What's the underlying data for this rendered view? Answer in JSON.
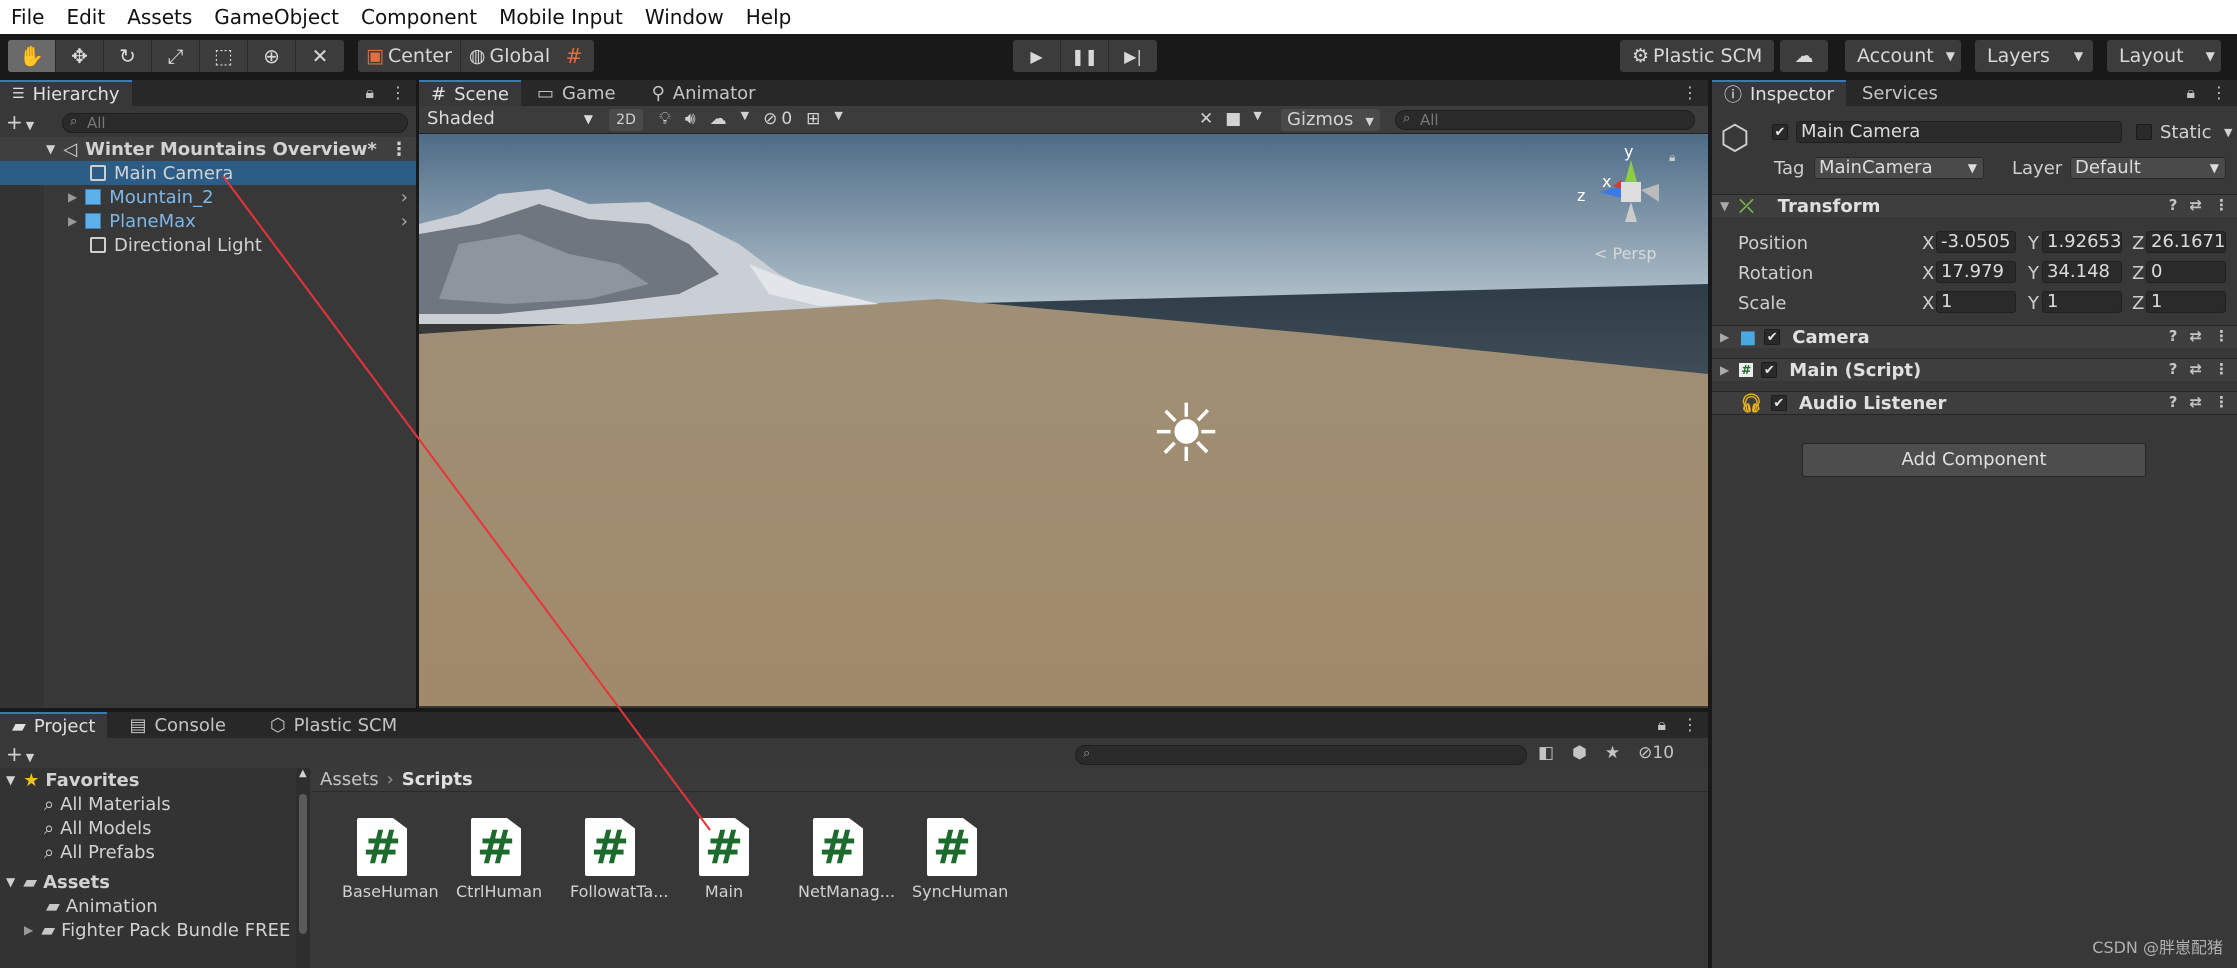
{
  "menu": [
    "File",
    "Edit",
    "Assets",
    "GameObject",
    "Component",
    "Mobile Input",
    "Window",
    "Help"
  ],
  "toolbar": {
    "pivot": "Center",
    "space": "Global",
    "plastic": "Plastic SCM",
    "account": "Account",
    "layers": "Layers",
    "layout": "Layout"
  },
  "hierarchy": {
    "tab": "Hierarchy",
    "search_placeholder": "All",
    "scene": "Winter Mountains  Overview*",
    "items": [
      "Main Camera",
      "Mountain_2",
      "PlaneMax",
      "Directional Light"
    ]
  },
  "scene": {
    "tabs": [
      "Scene",
      "Game",
      "Animator"
    ],
    "shading": "Shaded",
    "mode2d": "2D",
    "hidden_count": "0",
    "gizmos": "Gizmos",
    "search_placeholder": "All",
    "persp": "< Persp",
    "axes": {
      "y": "y",
      "x": "x",
      "z": "z"
    }
  },
  "inspector": {
    "tabs": [
      "Inspector",
      "Services"
    ],
    "object_name": "Main Camera",
    "static_label": "Static",
    "tag_label": "Tag",
    "tag_value": "MainCamera",
    "layer_label": "Layer",
    "layer_value": "Default",
    "transform": {
      "title": "Transform",
      "position": {
        "label": "Position",
        "x": "-3.0505",
        "y": "1.92653",
        "z": "26.1671"
      },
      "rotation": {
        "label": "Rotation",
        "x": "17.979",
        "y": "34.148",
        "z": "0"
      },
      "scale": {
        "label": "Scale",
        "x": "1",
        "y": "1",
        "z": "1"
      }
    },
    "components": [
      "Camera",
      "Main (Script)",
      "Audio Listener"
    ],
    "add_component": "Add Component"
  },
  "project": {
    "tabs": [
      "Project",
      "Console",
      "Plastic SCM"
    ],
    "hidden_count": "10",
    "favorites_label": "Favorites",
    "favorites": [
      "All Materials",
      "All Models",
      "All Prefabs"
    ],
    "assets_label": "Assets",
    "folders": [
      "Animation",
      "Fighter Pack Bundle FREE"
    ],
    "breadcrumb": {
      "root": "Assets",
      "current": "Scripts"
    },
    "scripts": [
      "BaseHuman",
      "CtrlHuman",
      "FollowatTa...",
      "Main",
      "NetManag...",
      "SyncHuman"
    ]
  },
  "watermark": "CSDN @胖崽配猪",
  "colors": {
    "selection": "#2c5d87",
    "accent_tab": "#3a79bb",
    "script_icon_green": "#1c6b2c",
    "annotation_line": "#e8333a"
  }
}
